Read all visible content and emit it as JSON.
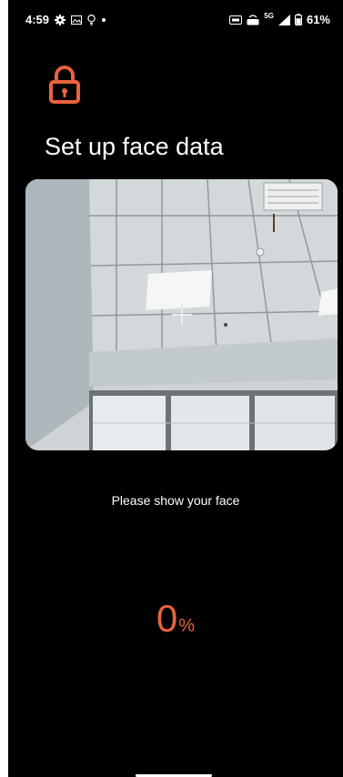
{
  "status_bar": {
    "time": "4:59",
    "network": "5G",
    "battery": "61%",
    "icons": [
      "settings-icon",
      "gallery-icon",
      "bulb-icon",
      "dot-icon",
      "hd-voice-icon",
      "volte-icon",
      "signal-icon",
      "battery-icon"
    ]
  },
  "header": {
    "icon": "lock-icon",
    "title": "Set up face data"
  },
  "camera": {
    "crosshair": "plus-icon"
  },
  "prompt": "Please show your face",
  "progress": {
    "value": "0",
    "unit": "%",
    "percent": 0
  },
  "colors": {
    "accent": "#e8633d",
    "background": "#000000",
    "text": "#ffffff"
  }
}
